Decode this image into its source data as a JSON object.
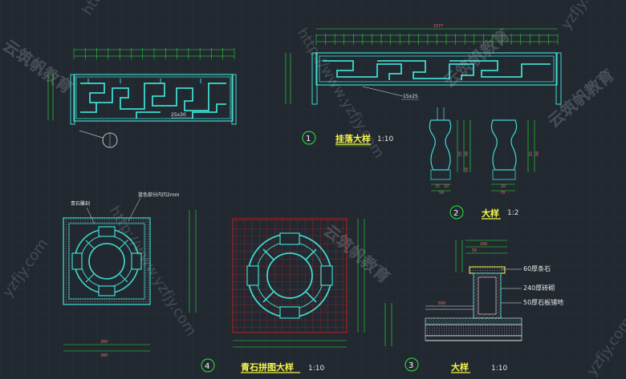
{
  "colors": {
    "background": "#212830",
    "grid": "#2b333c",
    "cyan": "#3fd9d0",
    "dimension": "#e06c6c",
    "green": "#2ee83a",
    "title": "#f7f74a",
    "white": "#e8e8e8",
    "red_grid": "#e02020"
  },
  "drawings": {
    "d1": {
      "number": "1",
      "title": "挂落大样",
      "scale": "1:10"
    },
    "d2": {
      "number": "2",
      "title": "大样",
      "scale": "1:2"
    },
    "d3": {
      "number": "3",
      "title": "大样",
      "scale": "1:10"
    },
    "d4": {
      "number": "4",
      "title": "青石拼图大样",
      "scale": "1:10"
    }
  },
  "annotations": {
    "section_size": "15x25",
    "frame_size": "25x30",
    "qingshi_label": "青石雕刻",
    "recess_note": "蓝色部分内凹2mm",
    "layer1": "60厚条石",
    "layer2": "240厚砖砌",
    "layer3": "50厚石板铺地"
  },
  "dims": {
    "top_total": "1577",
    "a_90": "90",
    "a_55": "55",
    "a_50": "50",
    "a_35": "35",
    "a_10": "10",
    "a_20": "20",
    "a_70": "70",
    "b_300": "300",
    "b_380": "380",
    "c_600": "600",
    "c_360": "360",
    "c_180": "180",
    "c_50": "50"
  },
  "watermarks": {
    "url": "http://www.yzfjy.com",
    "brand": "云筑帆教育",
    "short": "yzfjy.com"
  }
}
